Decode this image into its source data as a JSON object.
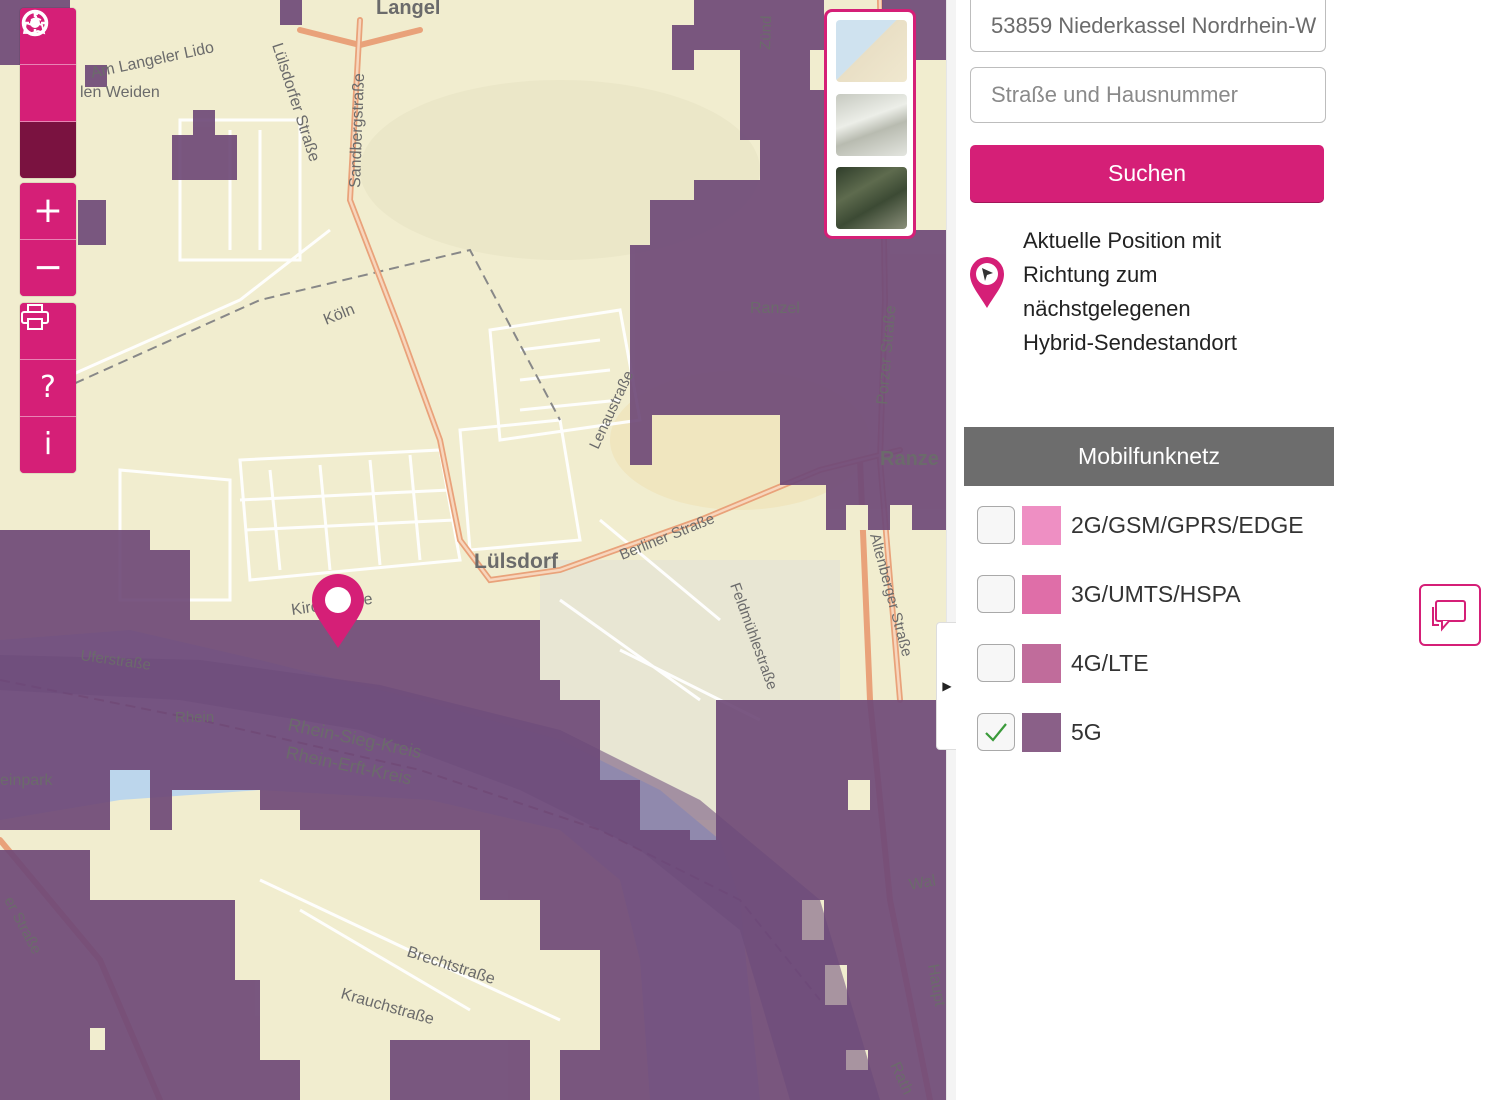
{
  "address": {
    "location_value": "53859 Niederkassel Nordrhein-W",
    "street_placeholder": "Straße und Hausnummer",
    "search_label": "Suchen"
  },
  "position_info": {
    "lines": [
      "Aktuelle Position mit",
      "Richtung zum",
      "nächstgelegenen",
      "Hybrid-Sendestandort"
    ]
  },
  "legend": {
    "title": "Mobilfunknetz",
    "items": [
      {
        "label": "2G/GSM/GPRS/EDGE",
        "color": "#ee8fc3",
        "checked": false
      },
      {
        "label": "3G/UMTS/HSPA",
        "color": "#df6ea8",
        "checked": false
      },
      {
        "label": "4G/LTE",
        "color": "#c06c9b",
        "checked": false
      },
      {
        "label": "5G",
        "color": "#8a6088",
        "checked": true
      }
    ]
  },
  "toolbar": {
    "icons": [
      "crosshair-icon",
      "locate-icon",
      "map-reader-icon",
      "zoom-in-icon",
      "zoom-out-icon",
      "print-icon",
      "help-icon",
      "info-icon"
    ],
    "zoom_in": "+",
    "zoom_out": "−",
    "help": "?",
    "info": "i"
  },
  "map_labels": {
    "langel": "Langel",
    "am_langeler_lido": "Am Langeler Lido",
    "weiden": "len Weiden",
    "lulsdorfer_strasse": "Lülsdorfer Straße",
    "sandbergstrasse": "Sandbergstraße",
    "koln": "Köln",
    "ranzel": "Ranzel",
    "ranze": "Ranze",
    "porzer_strasse": "Porzer Straße",
    "lenaustrasse": "Lenaustraße",
    "lulsdorf": "Lülsdorf",
    "berliner_strasse": "Berliner Straße",
    "kirchstrasse": "Kirchstraße",
    "uferstrasse": "Uferstraße",
    "rhein": "Rhein",
    "rhein_sieg_kreis": "Rhein-Sieg-Kreis",
    "rhein_erft_kreis": "Rhein-Erft-Kreis",
    "einpark": "einpark",
    "feldmuhlestrasse": "Feldmühlestraße",
    "altenberger_strasse": "Altenberger Straße",
    "brechtstrasse": "Brechtstraße",
    "krauchstrasse": "Krauchstraße",
    "strasse_left": "er Straße",
    "zund": "Zünd",
    "wal": "Wal",
    "haupt": "Haupt",
    "rath": "Rath"
  },
  "colors": {
    "brand": "#d51f77",
    "coverage_5g": "#6f4a78",
    "map_bg": "#f1edcf",
    "river": "#bcd6ec"
  }
}
